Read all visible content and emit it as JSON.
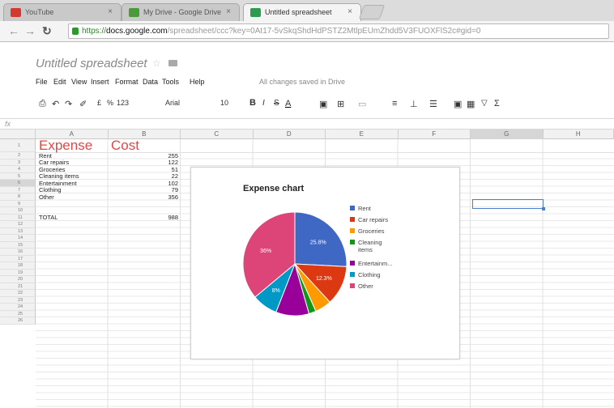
{
  "browser": {
    "tabs": [
      {
        "label": "YouTube",
        "icon": "youtube-icon",
        "color": "#d23a2f"
      },
      {
        "label": "My Drive - Google Drive",
        "icon": "drive-icon",
        "color": "#4a9a3a"
      },
      {
        "label": "Untitled spreadsheet",
        "icon": "sheets-icon",
        "color": "#2e9c4e"
      }
    ],
    "tab_close": "×",
    "url": {
      "proto": "https://",
      "host": "docs.google.com",
      "path": "/spreadsheet/ccc?key=0At17-5vSkqShdHdPSTZ2MtlpEUmZhdd5V3FUOXFlS2c#gid=0"
    }
  },
  "app": {
    "title": "Untitled spreadsheet",
    "menu": [
      "File",
      "Edit",
      "View",
      "Insert",
      "Format",
      "Data",
      "Tools",
      "Help"
    ],
    "save_status": "All changes saved in Drive",
    "toolbar": {
      "currency": "£",
      "percent": "%",
      "number_format": "123",
      "font": "Arial",
      "font_size": "10",
      "bold": "B",
      "italic": "I",
      "strike": "S",
      "text_color": "A",
      "sum": "Σ"
    },
    "fx_label": "fx",
    "columns": [
      "A",
      "B",
      "C",
      "D",
      "E",
      "F",
      "G",
      "H"
    ],
    "selected_column": "G",
    "rows": [
      "1",
      "2",
      "3",
      "4",
      "5",
      "6",
      "7",
      "8",
      "9",
      "10",
      "11",
      "12",
      "13",
      "14",
      "15",
      "16",
      "17",
      "18",
      "19",
      "20",
      "21",
      "22",
      "23",
      "24",
      "25",
      "26"
    ],
    "selected_row": "6",
    "sheet": {
      "header_a": "Expense",
      "header_b": "Cost",
      "items": [
        {
          "label": "Rent",
          "value": "255"
        },
        {
          "label": "Car repairs",
          "value": "122"
        },
        {
          "label": "Groceries",
          "value": "51"
        },
        {
          "label": "Cleaning items",
          "value": "22"
        },
        {
          "label": "Entertainment",
          "value": "102"
        },
        {
          "label": "Clothing",
          "value": "79"
        },
        {
          "label": "Other",
          "value": "356"
        }
      ],
      "total_label": "TOTAL",
      "total_value": "988"
    }
  },
  "chart_data": {
    "type": "pie",
    "title": "Expense chart",
    "categories": [
      "Rent",
      "Car repairs",
      "Groceries",
      "Cleaning items",
      "Entertainment",
      "Clothing",
      "Other"
    ],
    "values": [
      255,
      122,
      51,
      22,
      102,
      79,
      356
    ],
    "legend_labels": [
      "Rent",
      "Car repairs",
      "Groceries",
      "Cleaning",
      "Entertainm...",
      "Clothing",
      "Other"
    ],
    "legend_extra": "items",
    "slice_labels": [
      "25.8%",
      "12.3%",
      "",
      "",
      "",
      "8%",
      "36%"
    ],
    "colors": [
      "#3f67c4",
      "#dc3912",
      "#ff9900",
      "#109618",
      "#990099",
      "#0099c6",
      "#dd4477"
    ],
    "legend_position": "right"
  }
}
